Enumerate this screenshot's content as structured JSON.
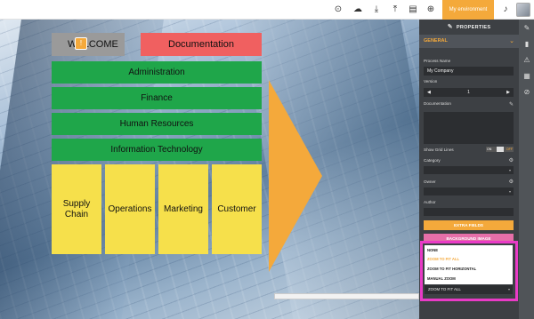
{
  "toolbar": {
    "icons": [
      "focus-icon",
      "cloud-icon",
      "download-icon",
      "upload-icon",
      "folder-icon",
      "add-circle-icon",
      "add-user-icon",
      "bell-icon"
    ],
    "environment_label": "My environment"
  },
  "canvas": {
    "welcome_label": "WELCOME",
    "documentation_label": "Documentation",
    "departments": [
      "Administration",
      "Finance",
      "Human Resources",
      "Information Technology"
    ],
    "units": [
      "Supply Chain",
      "Operations",
      "Marketing",
      "Customer"
    ],
    "colors": {
      "welcome": "#9a9a9a",
      "documentation": "#f06060",
      "department": "#1fa64a",
      "unit": "#f6e04b",
      "arrow": "#f4a93b"
    }
  },
  "properties": {
    "title": "PROPERTIES",
    "section": "GENERAL",
    "process_name_label": "Process Name",
    "process_name_value": "My Company",
    "version_label": "Version",
    "version_value": "1",
    "documentation_label": "Documentation",
    "show_grid_lines_label": "Show Grid Lines",
    "toggle_on": "ON",
    "toggle_off": "OFF",
    "category_label": "Category",
    "owner_label": "Owner",
    "author_label": "Author",
    "extra_fields_button": "EXTRA FIELDS",
    "background_image_button": "BACKGROUND IMAGE",
    "zoom_options": [
      "NONE",
      "ZOOM TO FIT ALL",
      "ZOOM TO FIT HORIZONTAL",
      "MANUAL ZOOM"
    ],
    "zoom_selected": "ZOOM TO FIT ALL",
    "accent_color": "#f4a93b",
    "highlight_color": "#e93bc6"
  },
  "right_strip": {
    "icons": [
      "wrench-icon",
      "brush-icon",
      "warning-icon",
      "notes-icon",
      "attachment-icon"
    ]
  }
}
